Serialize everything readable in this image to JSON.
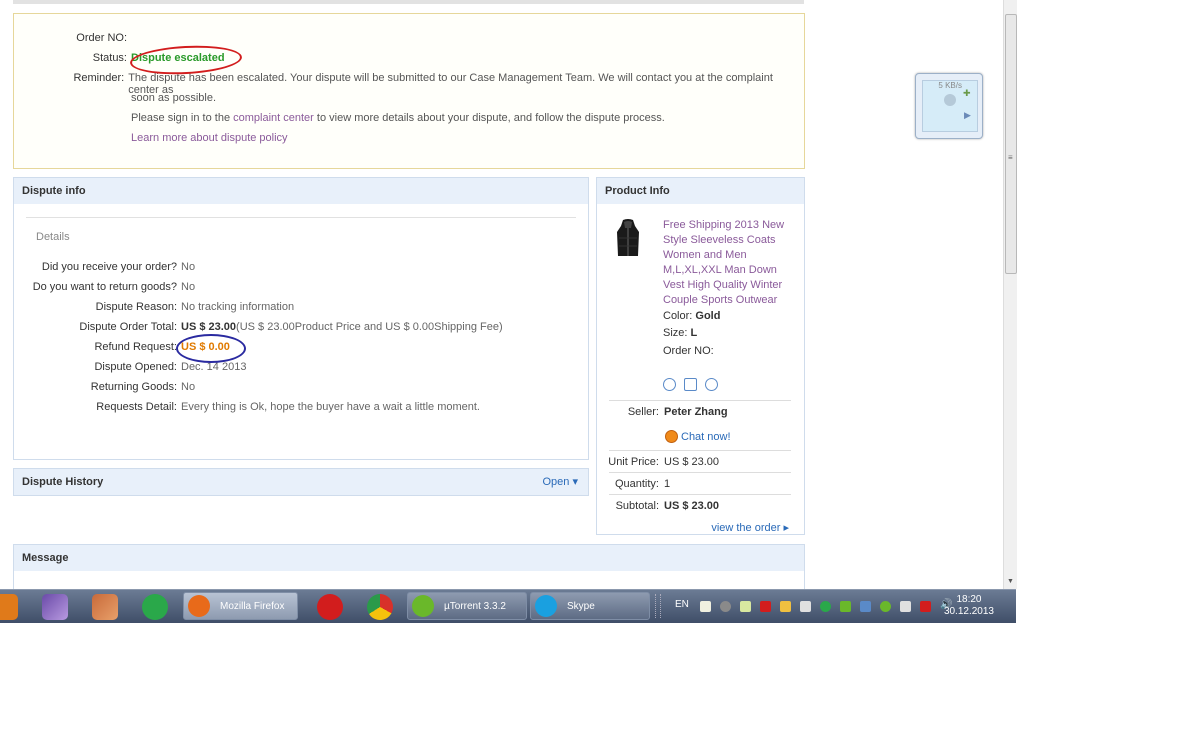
{
  "status_box": {
    "order_no_label": "Order NO:",
    "order_no_value": "",
    "status_label": "Status:",
    "status_value": "Dispute escalated",
    "reminder_label": "Reminder:",
    "reminder_line1": "The dispute has been escalated. Your dispute will be submitted to our Case Management Team. We will contact you at the complaint center as",
    "reminder_line2": "soon as possible.",
    "signin_before": "Please sign in to the ",
    "signin_link": "complaint center",
    "signin_after": " to view more details about your dispute, and follow the dispute process.",
    "learn_more": "Learn more about dispute policy"
  },
  "dispute_info": {
    "title": "Dispute info",
    "details_title": "Details",
    "rows": [
      {
        "label": "Did you receive your order?",
        "value": "No"
      },
      {
        "label": "Do you want to return goods?",
        "value": "No"
      },
      {
        "label": "Dispute Reason:",
        "value": "No tracking information"
      },
      {
        "label": "Dispute Order Total:",
        "value_bold": "US $ 23.00",
        "value_rest": "(US $ 23.00Product Price and US $ 0.00Shipping Fee)"
      },
      {
        "label": "Refund Request:",
        "value": "US $ 0.00"
      },
      {
        "label": "Dispute Opened:",
        "value": "Dec. 14 2013"
      },
      {
        "label": "Returning Goods:",
        "value": "No"
      },
      {
        "label": "Requests Detail:",
        "value": "Every thing is Ok, hope the buyer have a wait a little moment."
      }
    ]
  },
  "dispute_history": {
    "title": "Dispute History",
    "open_label": "Open"
  },
  "message": {
    "title": "Message"
  },
  "product_info": {
    "title": "Product Info",
    "product_title": "Free Shipping 2013 New Style Sleeveless Coats Women and Men M,L,XL,XXL Man Down Vest High Quality Winter Couple Sports Outwear",
    "color_label": "Color:",
    "color_value": "Gold",
    "size_label": "Size:",
    "size_value": "L",
    "order_no_label": "Order NO:",
    "seller_label": "Seller:",
    "seller_value": "Peter Zhang",
    "chat_label": "Chat now!",
    "unit_price_label": "Unit Price:",
    "unit_price_value": "US $ 23.00",
    "quantity_label": "Quantity:",
    "quantity_value": "1",
    "subtotal_label": "Subtotal:",
    "subtotal_value": "US $ 23.00",
    "view_order": "view the order"
  },
  "speed_widget": {
    "text": "5 KB/s"
  },
  "taskbar": {
    "buttons": [
      {
        "label": "Mozilla Firefox",
        "color": "#e86a1a"
      },
      {
        "label": "µTorrent 3.3.2",
        "color": "#6ab82a"
      },
      {
        "label": "Skype",
        "color": "#1aa0e0"
      }
    ],
    "language": "EN",
    "time": "18:20",
    "date": "30.12.2013"
  }
}
